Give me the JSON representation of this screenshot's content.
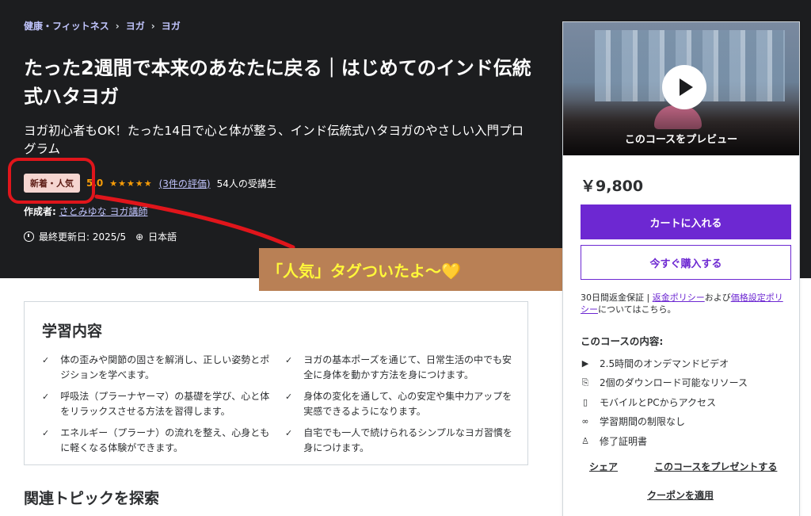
{
  "breadcrumb": [
    "健康・フィットネス",
    "ヨガ",
    "ヨガ"
  ],
  "course": {
    "title": "たった2週間で本来のあなたに戻る｜はじめてのインド伝統式ハタヨガ",
    "subtitle": "ヨガ初心者もOK！たった14日で心と体が整う、インド伝統式ハタヨガのやさしい入門プログラム",
    "badge": "新着・人気",
    "rating": "5.0",
    "stars": "★★★★★",
    "reviews": "(3件の評価)",
    "students": "54人の受講生",
    "author_label": "作成者:",
    "author": "さとみゆな ヨガ講師",
    "updated": "最終更新日: 2025/5",
    "language": "日本語"
  },
  "annotation": {
    "text": "「人気」タグついたよ〜💛"
  },
  "sidebar": {
    "preview_label": "このコースをプレビュー",
    "price": "￥9,800",
    "add_to_cart": "カートに入れる",
    "buy_now": "今すぐ購入する",
    "guarantee_pre": "30日間返金保証 | ",
    "refund_link": "返金ポリシー",
    "guarantee_mid": "および",
    "pricing_link": "価格設定ポリシー",
    "guarantee_post": "についてはこちら。",
    "includes_title": "このコースの内容:",
    "includes": [
      {
        "icon": "video-icon",
        "glyph": "▶",
        "text": "2.5時間のオンデマンドビデオ"
      },
      {
        "icon": "file-icon",
        "glyph": "⎘",
        "text": "2個のダウンロード可能なリソース"
      },
      {
        "icon": "mobile-icon",
        "glyph": "▯",
        "text": "モバイルとPCからアクセス"
      },
      {
        "icon": "infinity-icon",
        "glyph": "∞",
        "text": "学習期間の制限なし"
      },
      {
        "icon": "trophy-icon",
        "glyph": "♙",
        "text": "修了証明書"
      }
    ],
    "share": "シェア",
    "gift": "このコースをプレゼントする",
    "coupon": "クーポンを適用"
  },
  "learn": {
    "title": "学習内容",
    "items": [
      "体の歪みや関節の固さを解消し、正しい姿勢とポジションを学べます。",
      "ヨガの基本ポーズを通じて、日常生活の中でも安全に身体を動かす方法を身につけます。",
      "呼吸法（プラーナヤーマ）の基礎を学び、心と体をリラックスさせる方法を習得します。",
      "身体の変化を通して、心の安定や集中力アップを実感できるようになります。",
      "エネルギー（プラーナ）の流れを整え、心身ともに軽くなる体験ができます。",
      "自宅でも一人で続けられるシンプルなヨガ習慣を身につけます。"
    ]
  },
  "topics_title": "関連トピックを探索",
  "colors": {
    "accent": "#6d28d2",
    "hero_bg": "#1c1d1f",
    "star": "#f69c08",
    "annotation": "#e0151b"
  }
}
